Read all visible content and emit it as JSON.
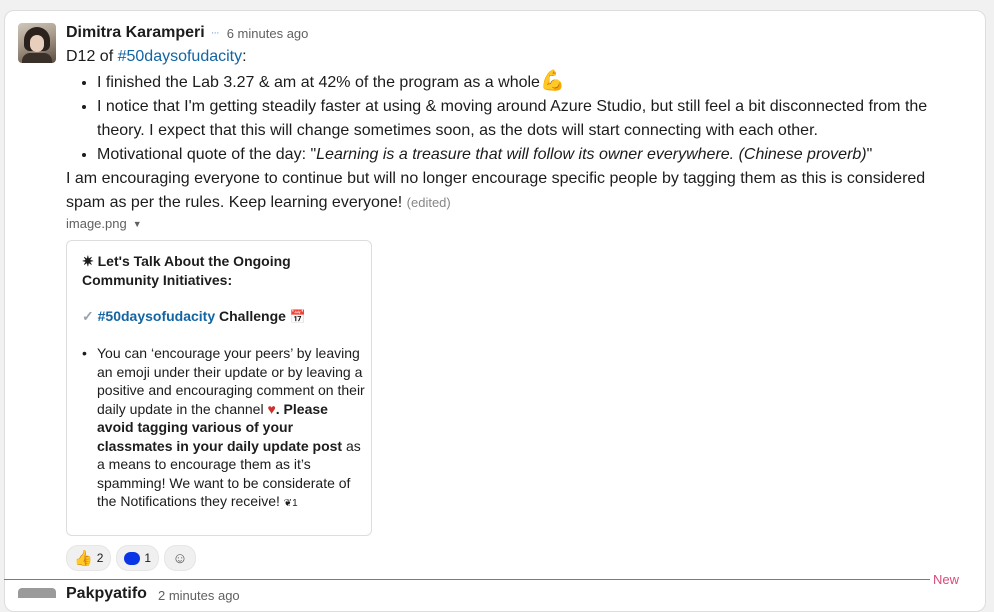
{
  "message": {
    "author": "Dimitra Karamperi",
    "status_emoji": "💬",
    "timestamp": "6 minutes ago",
    "intro_prefix": "D12 of ",
    "channel": "#50daysofudacity",
    "intro_suffix": ":",
    "bullets": [
      "I finished the Lab 3.27 & am at 42% of the program as a whole",
      "I notice that I'm getting steadily faster at using & moving around Azure Studio, but still feel a bit disconnected from the theory. I expect that this will change sometimes soon, as the dots will start connecting with each other.",
      "Motivational quote of the day: \""
    ],
    "muscle_emoji": "💪",
    "quote": "Learning is a treasure that will follow its owner everywhere. (Chinese proverb)",
    "quote_end": "\"",
    "closing": "I am encouraging everyone to continue but will no longer encourage specific people by tagging them as this is considered spam as per the rules. Keep learning everyone!",
    "edited": "(edited)"
  },
  "attachment": {
    "filename": "image.png",
    "caret": "▼",
    "title": "Let's Talk About the Ongoing Community Initiatives:",
    "title_icon": "✷",
    "challenge_check": "✓",
    "challenge_link": "#50daysofudacity",
    "challenge_word": "Challenge",
    "calendar_icon": "📅",
    "bullet_dot": "•",
    "body_normal_1": "You can ‘encourage your peers’ by leaving an emoji under their update or by leaving a positive and encouraging comment on their daily update in the channel ",
    "heart": "♥",
    "body_bold": ". Please avoid tagging various of your classmates in your daily update post",
    "body_normal_2": " as a means to encourage them as it’s spamming! We want to be considerate of the Notifications they receive!",
    "end_mark": "❦1"
  },
  "reactions": [
    {
      "icon": "thumbs-up",
      "count": "2",
      "glyph": "👍"
    },
    {
      "icon": "blue-blob",
      "count": "1"
    }
  ],
  "add_reaction_glyph": "☺",
  "new_label": "New",
  "next_message": {
    "author": "Pakpyatifo",
    "timestamp": "2 minutes ago"
  },
  "colors": {
    "link": "#1264a3",
    "new_divider": "#d94b7b"
  }
}
